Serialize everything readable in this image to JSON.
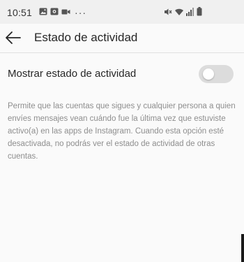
{
  "status_bar": {
    "time": "10:51",
    "more": "···",
    "left_icons": [
      "image-icon",
      "photo-app-icon",
      "video-icon"
    ],
    "right_icons": [
      "mute-icon",
      "wifi-icon",
      "signal-icon",
      "battery-icon"
    ]
  },
  "app_bar": {
    "back_icon": "arrow-left-icon",
    "title": "Estado de actividad"
  },
  "setting": {
    "label": "Mostrar estado de actividad",
    "enabled": false,
    "description": "Permite que las cuentas que sigues y cualquier persona a quien envíes mensajes vean cuándo fue la última vez que estuviste activo(a) en las apps de Instagram. Cuando esta opción esté desactivada, no podrás ver el estado de actividad de otras cuentas."
  },
  "colors": {
    "toggle_off": "#dcdcdc",
    "description_text": "#8e8e8e",
    "status_bar_bg": "#f0f0f0"
  }
}
